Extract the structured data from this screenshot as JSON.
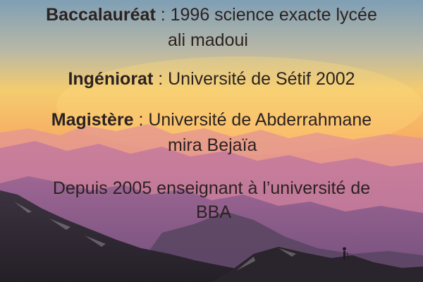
{
  "entries": [
    {
      "label": "Baccalauréat",
      "sep": " : ",
      "text": "1996 science exacte lycée",
      "cont": "ali madoui"
    },
    {
      "label": "Ingéniorat",
      "sep": " : ",
      "text": "Université de Sétif 2002"
    },
    {
      "label": "Magistère",
      "sep": " : ",
      "text": "Université de Abderrahmane",
      "cont": "mira Bejaïa"
    },
    {
      "text": "Depuis 2005 enseignant à l’université de",
      "cont": "BBA"
    }
  ],
  "colors": {
    "text": "#2b2222",
    "sky_top": "#8fa6b6",
    "sky_mid": "#f2c56a",
    "sky_low": "#f49a7a",
    "mountain_far": "#d78da0",
    "mountain_mid": "#a86f98",
    "mountain_front": "#2d2730"
  },
  "background_icon": "mountain-sunset-landscape"
}
